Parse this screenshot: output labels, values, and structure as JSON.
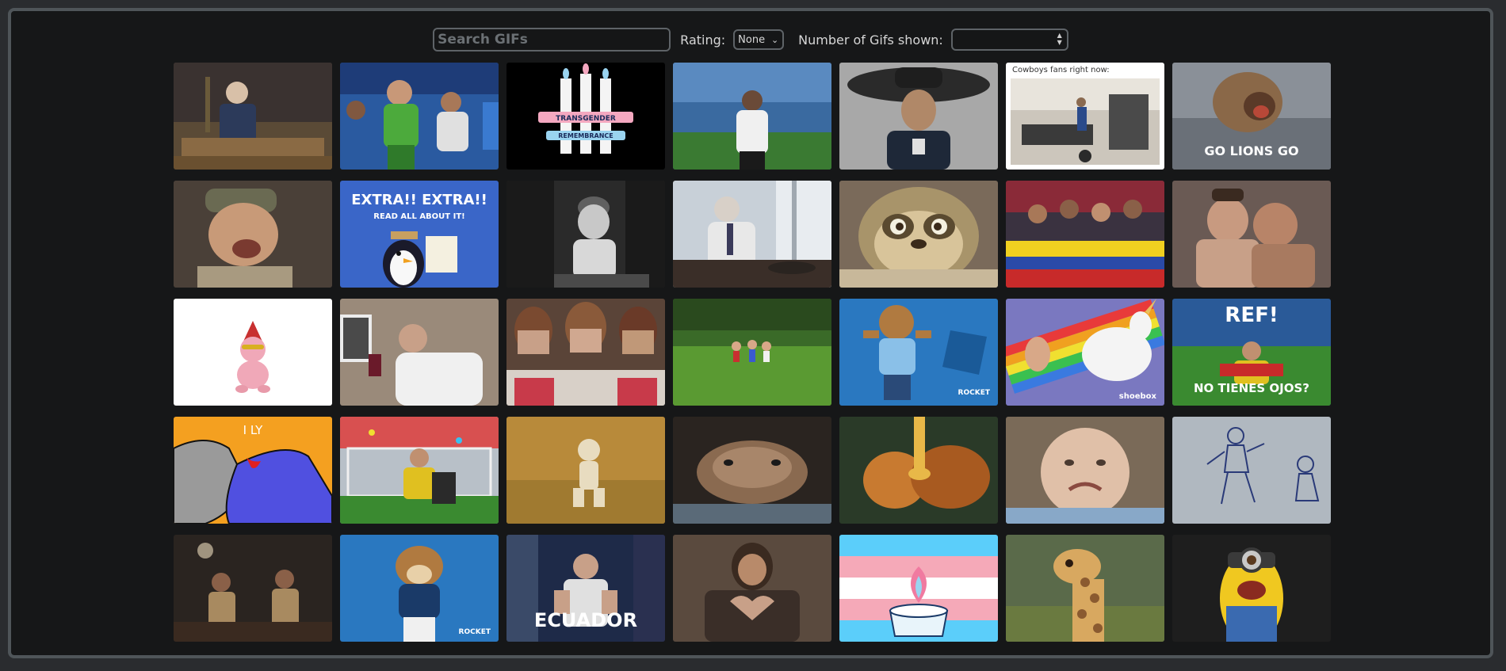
{
  "search": {
    "placeholder": "Search GIFs",
    "value": ""
  },
  "rating": {
    "label": "Rating:",
    "selected": "None"
  },
  "count": {
    "label": "Number of Gifs shown:",
    "value": ""
  },
  "gifs": [
    {
      "name": "gif-politician-at-podium"
    },
    {
      "name": "gif-cheering-kids"
    },
    {
      "name": "gif-transgender-remembrance-candles"
    },
    {
      "name": "gif-player-covering-face"
    },
    {
      "name": "gif-man-in-sombrero"
    },
    {
      "name": "gif-cowboys-fans-meme",
      "caption": "Cowboys fans right now:"
    },
    {
      "name": "gif-go-lions-go",
      "caption": "GO LIONS GO"
    },
    {
      "name": "gif-laughing-man-in-cap"
    },
    {
      "name": "gif-extra-extra-penguin",
      "caption": "EXTRA!! EXTRA!!",
      "caption2": "READ ALL ABOUT IT!"
    },
    {
      "name": "gif-thinking-boy-bw"
    },
    {
      "name": "gif-politician-at-desk"
    },
    {
      "name": "gif-sloth"
    },
    {
      "name": "gif-fans-with-flag"
    },
    {
      "name": "gif-hugging-couple"
    },
    {
      "name": "gif-baby-gnome"
    },
    {
      "name": "gif-man-drinking-wine"
    },
    {
      "name": "gif-cheerleaders-covering-faces"
    },
    {
      "name": "gif-kids-in-meadow"
    },
    {
      "name": "gif-lions-mascot-flexing",
      "watermark": "ROCKET"
    },
    {
      "name": "gif-unicorn-rainbow",
      "watermark": "shoebox"
    },
    {
      "name": "gif-ref-no-tienes-ojos",
      "caption": "REF!",
      "caption2": "NO TIENES OJOS?"
    },
    {
      "name": "gif-ily-cats",
      "caption": "I LY"
    },
    {
      "name": "gif-player-with-flag-confetti"
    },
    {
      "name": "gif-dancing-skeleton"
    },
    {
      "name": "gif-furry-creature"
    },
    {
      "name": "gif-syrup-pour"
    },
    {
      "name": "gif-crying-baby"
    },
    {
      "name": "gif-football-sketch"
    },
    {
      "name": "gif-crowd-night"
    },
    {
      "name": "gif-lions-mascot-dancing",
      "watermark": "ROCKET"
    },
    {
      "name": "gif-ecuador-fan",
      "caption": "ECUADOR"
    },
    {
      "name": "gif-man-heart-hands"
    },
    {
      "name": "gif-trans-flag-candle"
    },
    {
      "name": "gif-giraffe"
    },
    {
      "name": "gif-minion"
    }
  ]
}
